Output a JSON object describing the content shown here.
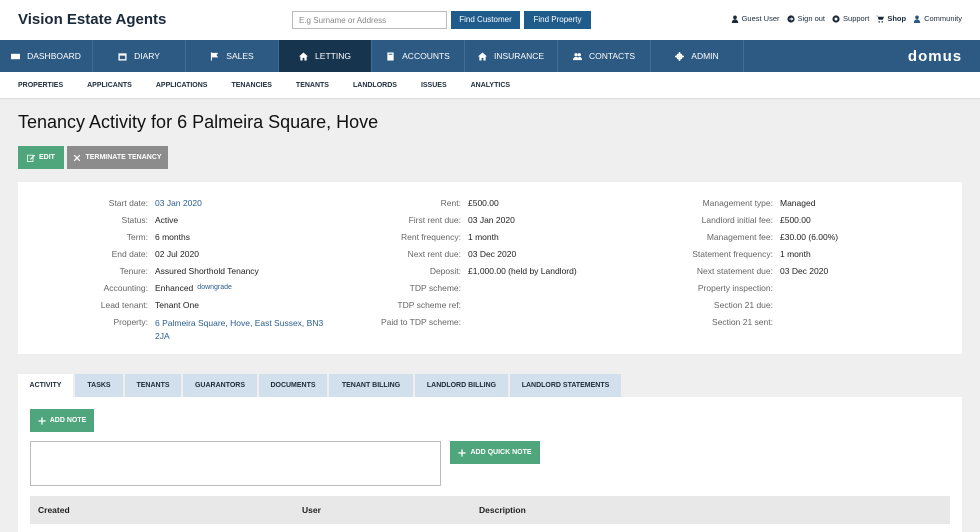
{
  "header": {
    "brand": "Vision Estate Agents",
    "search_placeholder": "E.g Surname or Address",
    "find_customer": "Find Customer",
    "find_property": "Find Property",
    "links": {
      "guest": "Guest User",
      "signout": "Sign out",
      "support": "Support",
      "shop": "Shop",
      "community": "Community"
    }
  },
  "nav": {
    "items": [
      "DASHBOARD",
      "DIARY",
      "SALES",
      "LETTING",
      "ACCOUNTS",
      "INSURANCE",
      "CONTACTS",
      "ADMIN"
    ],
    "active": "LETTING",
    "logo": "domus"
  },
  "subnav": [
    "PROPERTIES",
    "APPLICANTS",
    "APPLICATIONS",
    "TENANCIES",
    "TENANTS",
    "LANDLORDS",
    "ISSUES",
    "ANALYTICS"
  ],
  "page": {
    "title": "Tenancy Activity for 6 Palmeira Square, Hove",
    "edit": "EDIT",
    "terminate": "TERMINATE TENANCY"
  },
  "details": {
    "col1": {
      "start_date_label": "Start date:",
      "start_date": "03 Jan 2020",
      "status_label": "Status:",
      "status": "Active",
      "term_label": "Term:",
      "term": "6 months",
      "end_date_label": "End date:",
      "end_date": "02 Jul 2020",
      "tenure_label": "Tenure:",
      "tenure": "Assured Shorthold Tenancy",
      "accounting_label": "Accounting:",
      "accounting": "Enhanced",
      "downgrade": "downgrade",
      "lead_tenant_label": "Lead tenant:",
      "lead_tenant": "Tenant One",
      "property_label": "Property:",
      "property_line1": "6 Palmeira Square, Hove, East Sussex, BN3",
      "property_line2": "2JA"
    },
    "col2": {
      "rent_label": "Rent:",
      "rent": "£500.00",
      "first_rent_due_label": "First rent due:",
      "first_rent_due": "03 Jan 2020",
      "rent_frequency_label": "Rent frequency:",
      "rent_frequency": "1 month",
      "next_rent_due_label": "Next rent due:",
      "next_rent_due": "03 Dec 2020",
      "deposit_label": "Deposit:",
      "deposit": "£1,000.00 (held by Landlord)",
      "tdp_scheme_label": "TDP scheme:",
      "tdp_scheme_ref_label": "TDP scheme ref:",
      "paid_to_tdp_label": "Paid to TDP scheme:"
    },
    "col3": {
      "management_type_label": "Management type:",
      "management_type": "Managed",
      "landlord_initial_fee_label": "Landlord initial fee:",
      "landlord_initial_fee": "£500.00",
      "management_fee_label": "Management fee:",
      "management_fee": "£30.00 (6.00%)",
      "statement_frequency_label": "Statement frequency:",
      "statement_frequency": "1 month",
      "next_statement_due_label": "Next statement due:",
      "next_statement_due": "03 Dec 2020",
      "property_inspection_label": "Property inspection:",
      "section21_due_label": "Section 21 due:",
      "section21_sent_label": "Section 21 sent:"
    }
  },
  "tabs": [
    "ACTIVITY",
    "TASKS",
    "TENANTS",
    "GUARANTORS",
    "DOCUMENTS",
    "TENANT BILLING",
    "LANDLORD BILLING",
    "LANDLORD STATEMENTS"
  ],
  "activity": {
    "add_note": "ADD NOTE",
    "add_quick_note": "ADD QUICK NOTE",
    "columns": [
      "Created",
      "User",
      "Description"
    ]
  },
  "colors": {
    "nav": "#2d5a83",
    "nav_active": "#17344f",
    "green": "#4fa67c",
    "grey_button": "#8c8c8c"
  }
}
